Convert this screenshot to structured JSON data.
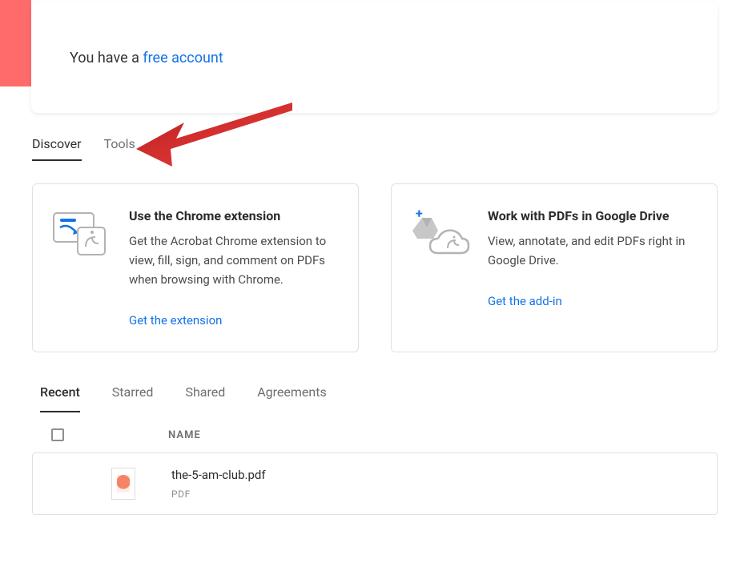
{
  "banner": {
    "prefix": "You have a ",
    "link_text": "free account"
  },
  "top_tabs": [
    {
      "label": "Discover",
      "active": true
    },
    {
      "label": "Tools",
      "active": false
    }
  ],
  "promo_cards": [
    {
      "title": "Use the Chrome extension",
      "description": "Get the Acrobat Chrome extension to view, fill, sign, and comment on PDFs when browsing with Chrome.",
      "link": "Get the extension"
    },
    {
      "title": "Work with PDFs in Google Drive",
      "description": "View, annotate, and edit PDFs right in Google Drive.",
      "link": "Get the add-in"
    }
  ],
  "file_tabs": [
    {
      "label": "Recent",
      "active": true
    },
    {
      "label": "Starred",
      "active": false
    },
    {
      "label": "Shared",
      "active": false
    },
    {
      "label": "Agreements",
      "active": false
    }
  ],
  "table": {
    "name_header": "NAME"
  },
  "files": [
    {
      "name": "the-5-am-club.pdf",
      "type": "PDF"
    }
  ]
}
